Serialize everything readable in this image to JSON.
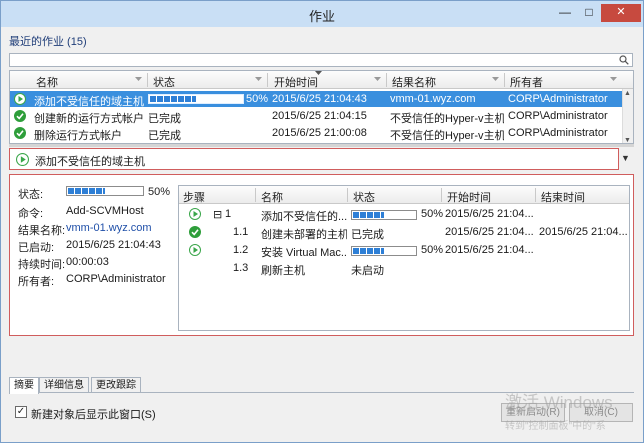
{
  "window": {
    "title": "作业",
    "minimize": "—",
    "maximize": "□",
    "close": "✕"
  },
  "recent": {
    "title": "最近的作业 (15)"
  },
  "grid": {
    "columns": [
      "名称",
      "状态",
      "开始时间",
      "结果名称",
      "所有者"
    ],
    "rows": [
      {
        "name": "添加不受信任的域主机",
        "status": "",
        "progress": 50,
        "progress_text": "50%",
        "start": "2015/6/25 21:04:43",
        "result": "vmm-01.wyz.com",
        "owner": "CORP\\Administrator",
        "icon": "running-icon",
        "selected": true
      },
      {
        "name": "创建新的运行方式帐户",
        "status": "已完成",
        "start": "2015/6/25 21:04:15",
        "result": "不受信任的Hyper-v主机",
        "owner": "CORP\\Administrator",
        "icon": "check-icon"
      },
      {
        "name": "删除运行方式帐户",
        "status": "已完成",
        "start": "2015/6/25 21:00:08",
        "result": "不受信任的Hyper-v主机",
        "owner": "CORP\\Administrator",
        "icon": "check-icon"
      }
    ]
  },
  "selected_job": {
    "title": "添加不受信任的域主机"
  },
  "details": {
    "status_label": "状态:",
    "status_progress": 50,
    "status_text": "50%",
    "command_label": "命令:",
    "command": "Add-SCVMHost",
    "result_label": "结果名称:",
    "result": "vmm-01.wyz.com",
    "started_label": "已启动:",
    "started": "2015/6/25 21:04:43",
    "duration_label": "持续时间:",
    "duration": "00:00:03",
    "owner_label": "所有者:",
    "owner": "CORP\\Administrator"
  },
  "steps": {
    "columns": [
      "步骤",
      "名称",
      "状态",
      "开始时间",
      "结束时间"
    ],
    "rows": [
      {
        "step": "1",
        "expander": "⊟",
        "name": "添加不受信任的...",
        "status": "",
        "progress": 50,
        "progress_text": "50%",
        "start": "2015/6/25 21:04...",
        "end": "",
        "icon": "running-icon"
      },
      {
        "step": "1.1",
        "name": "创建未部署的主机",
        "status": "已完成",
        "start": "2015/6/25 21:04...",
        "end": "2015/6/25 21:04...",
        "icon": "check-icon"
      },
      {
        "step": "1.2",
        "name": "安装 Virtual Mac...",
        "status": "",
        "progress": 50,
        "progress_text": "50%",
        "start": "2015/6/25 21:04...",
        "end": "",
        "icon": "running-icon"
      },
      {
        "step": "1.3",
        "name": "刷新主机",
        "status": "未启动",
        "start": "",
        "end": "",
        "icon": ""
      }
    ]
  },
  "tabs": [
    "摘要",
    "详细信息",
    "更改跟踪"
  ],
  "footer": {
    "checkbox_label": "新建对象后显示此窗口(S)",
    "checkbox_mark": "✓",
    "restart_label": "重新启动(R)",
    "cancel_label": "取消(C)"
  },
  "watermark": {
    "line1": "激活 Windows",
    "line2": "转到\"控制面板\"中的\"系"
  },
  "colors": {
    "accent": "#3a8fde",
    "highlight_border": "#d05d5d",
    "progress": "#2e7fd6",
    "success": "#2e9e3a",
    "running": "#3aa64a"
  }
}
